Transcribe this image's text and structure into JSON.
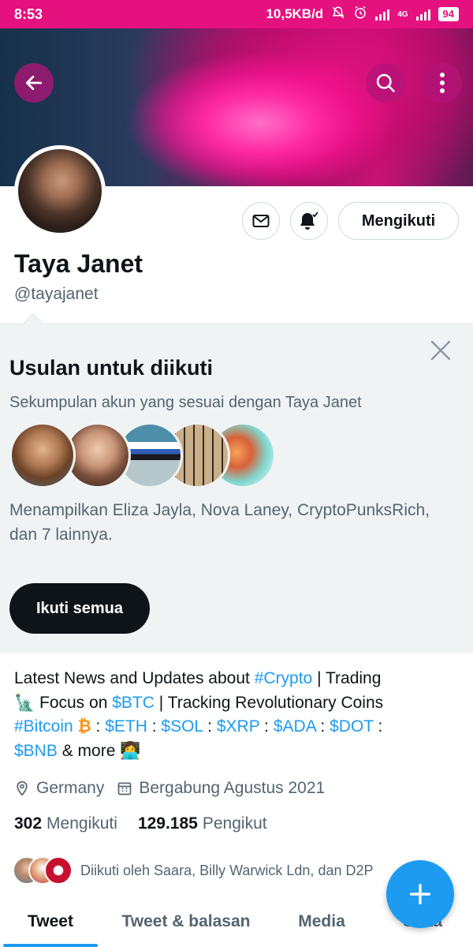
{
  "status": {
    "time": "8:53",
    "speed": "10,5KB/d",
    "network": "4G",
    "battery": "94"
  },
  "profile": {
    "name": "Taya Janet",
    "handle": "@tayajanet",
    "follow_label": "Mengikuti"
  },
  "suggestion": {
    "title": "Usulan untuk diikuti",
    "subtitle": "Sekumpulan akun yang sesuai dengan Taya Janet",
    "description": "Menampilkan Eliza Jayla, Nova Laney, CryptoPunksRich, dan 7 lainnya.",
    "follow_all": "Ikuti semua"
  },
  "bio": {
    "line1_a": "Latest News and Updates about ",
    "line1_tag": "#Crypto",
    "line1_b": " | Trading",
    "line2_emoji": "🗽",
    "line2_a": " Focus on ",
    "line2_tag": "$BTC",
    "line2_b": " | Tracking Revolutionary Coins",
    "tag_bitcoin": "#Bitcoin",
    "btc_emoji": "₿",
    "sep1": "  : ",
    "tag_eth": "$ETH",
    "sep2": " : ",
    "tag_sol": "$SOL",
    "sep3": " : ",
    "tag_xrp": "$XRP",
    "sep4": " : ",
    "tag_ada": "$ADA",
    "sep5": " : ",
    "tag_dot": "$DOT",
    "sep6": " :",
    "tag_bnb": "$BNB",
    "more": " & more ",
    "laptop_emoji": "👩‍💻"
  },
  "meta": {
    "location": "Germany",
    "joined": "Bergabung Agustus 2021"
  },
  "stats": {
    "following_count": "302",
    "following_label": "Mengikuti",
    "followers_count": "129.185",
    "followers_label": "Pengikut"
  },
  "followed_by": "Diikuti oleh Saara, Billy Warwick Ldn, dan D2P",
  "tabs": [
    "Tweet",
    "Tweet & balasan",
    "Media",
    "Suka"
  ],
  "colors": {
    "accent": "#1d9bf0",
    "status_bar": "#e5117f"
  }
}
